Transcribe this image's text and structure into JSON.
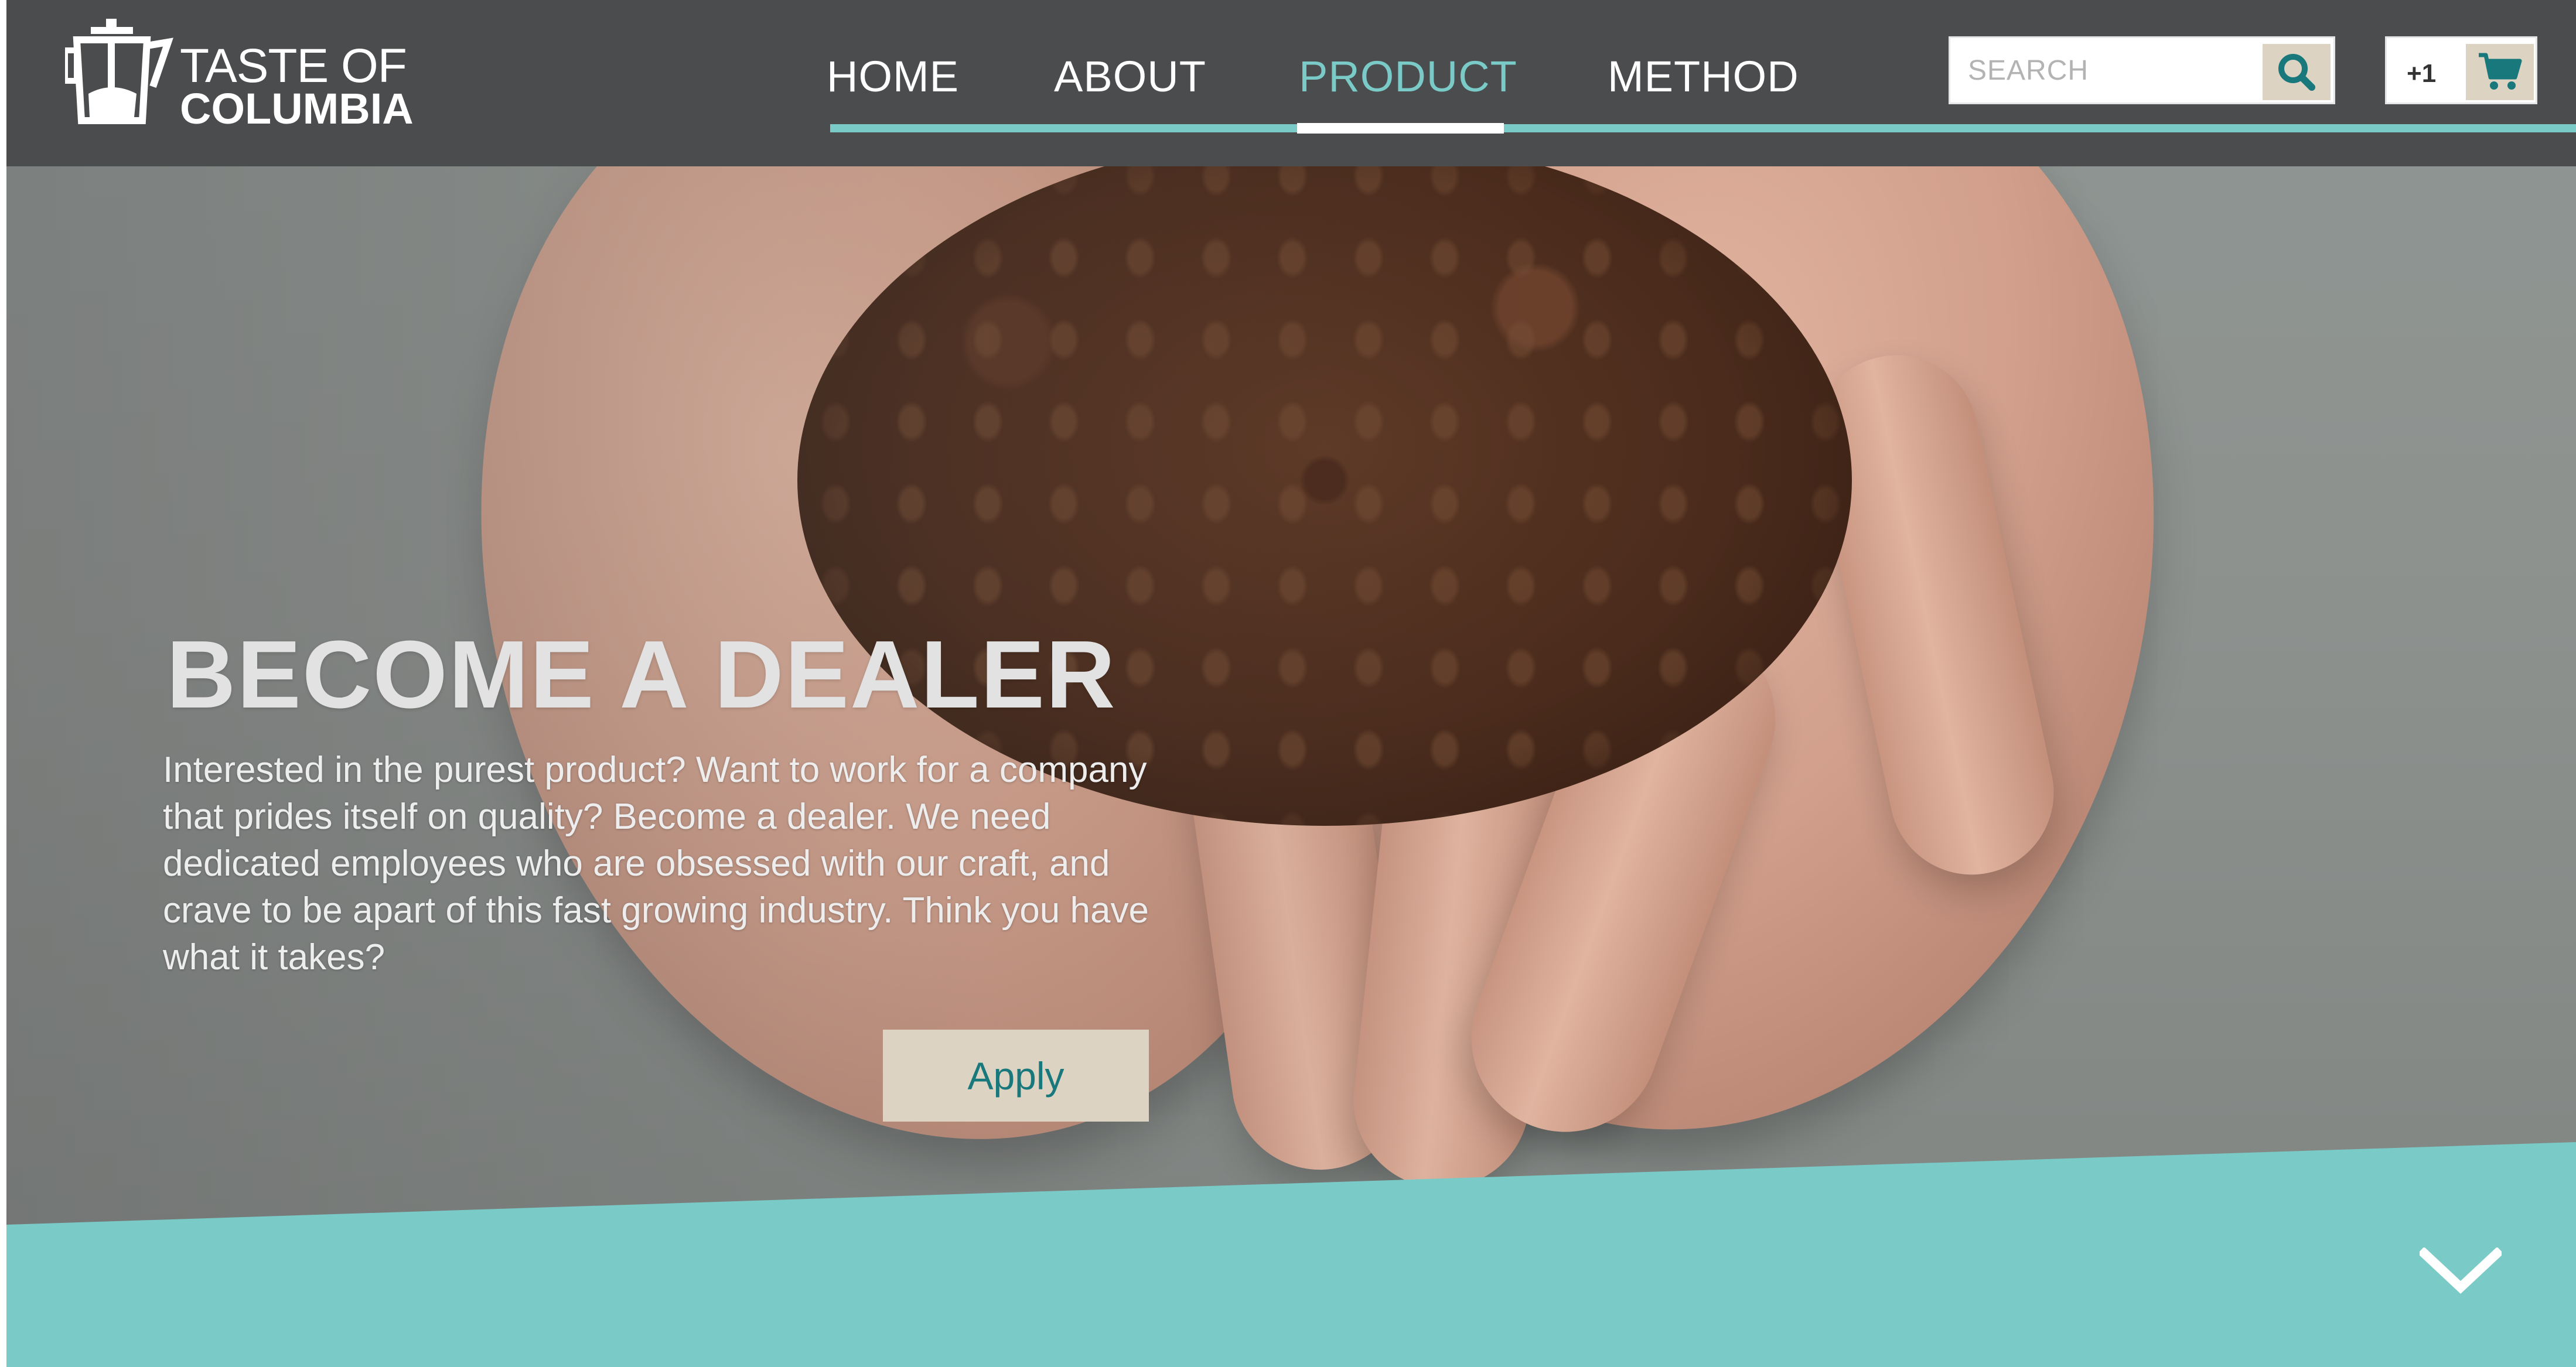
{
  "brand": {
    "name_line1": "TASTE OF",
    "name_line2": "COLUMBIA",
    "logo_icon": "coffee-press-icon"
  },
  "nav": {
    "items": [
      {
        "label": "HOME",
        "active": false
      },
      {
        "label": "ABOUT",
        "active": false
      },
      {
        "label": "PRODUCT",
        "active": true
      },
      {
        "label": "METHOD",
        "active": false
      }
    ]
  },
  "search": {
    "placeholder": "SEARCH",
    "value": "",
    "icon": "search-icon"
  },
  "cart": {
    "count": "+1",
    "icon": "cart-icon"
  },
  "hero": {
    "title": "BECOME A DEALER",
    "body": "Interested in the purest product? Want to work for a company that prides itself on quality? Become a dealer. We need dedicated employees who are obsessed with our craft, and crave to be apart of this fast growing industry. Think you have what it takes?",
    "cta_label": "Apply",
    "background": "hands-holding-coffee-beans-photo"
  },
  "scroll": {
    "icon": "chevron-down-icon"
  },
  "colors": {
    "header_bg": "#4b4c4e",
    "accent_teal": "#7acac8",
    "button_beige": "#dcd3c3",
    "button_text_teal": "#19787c"
  }
}
